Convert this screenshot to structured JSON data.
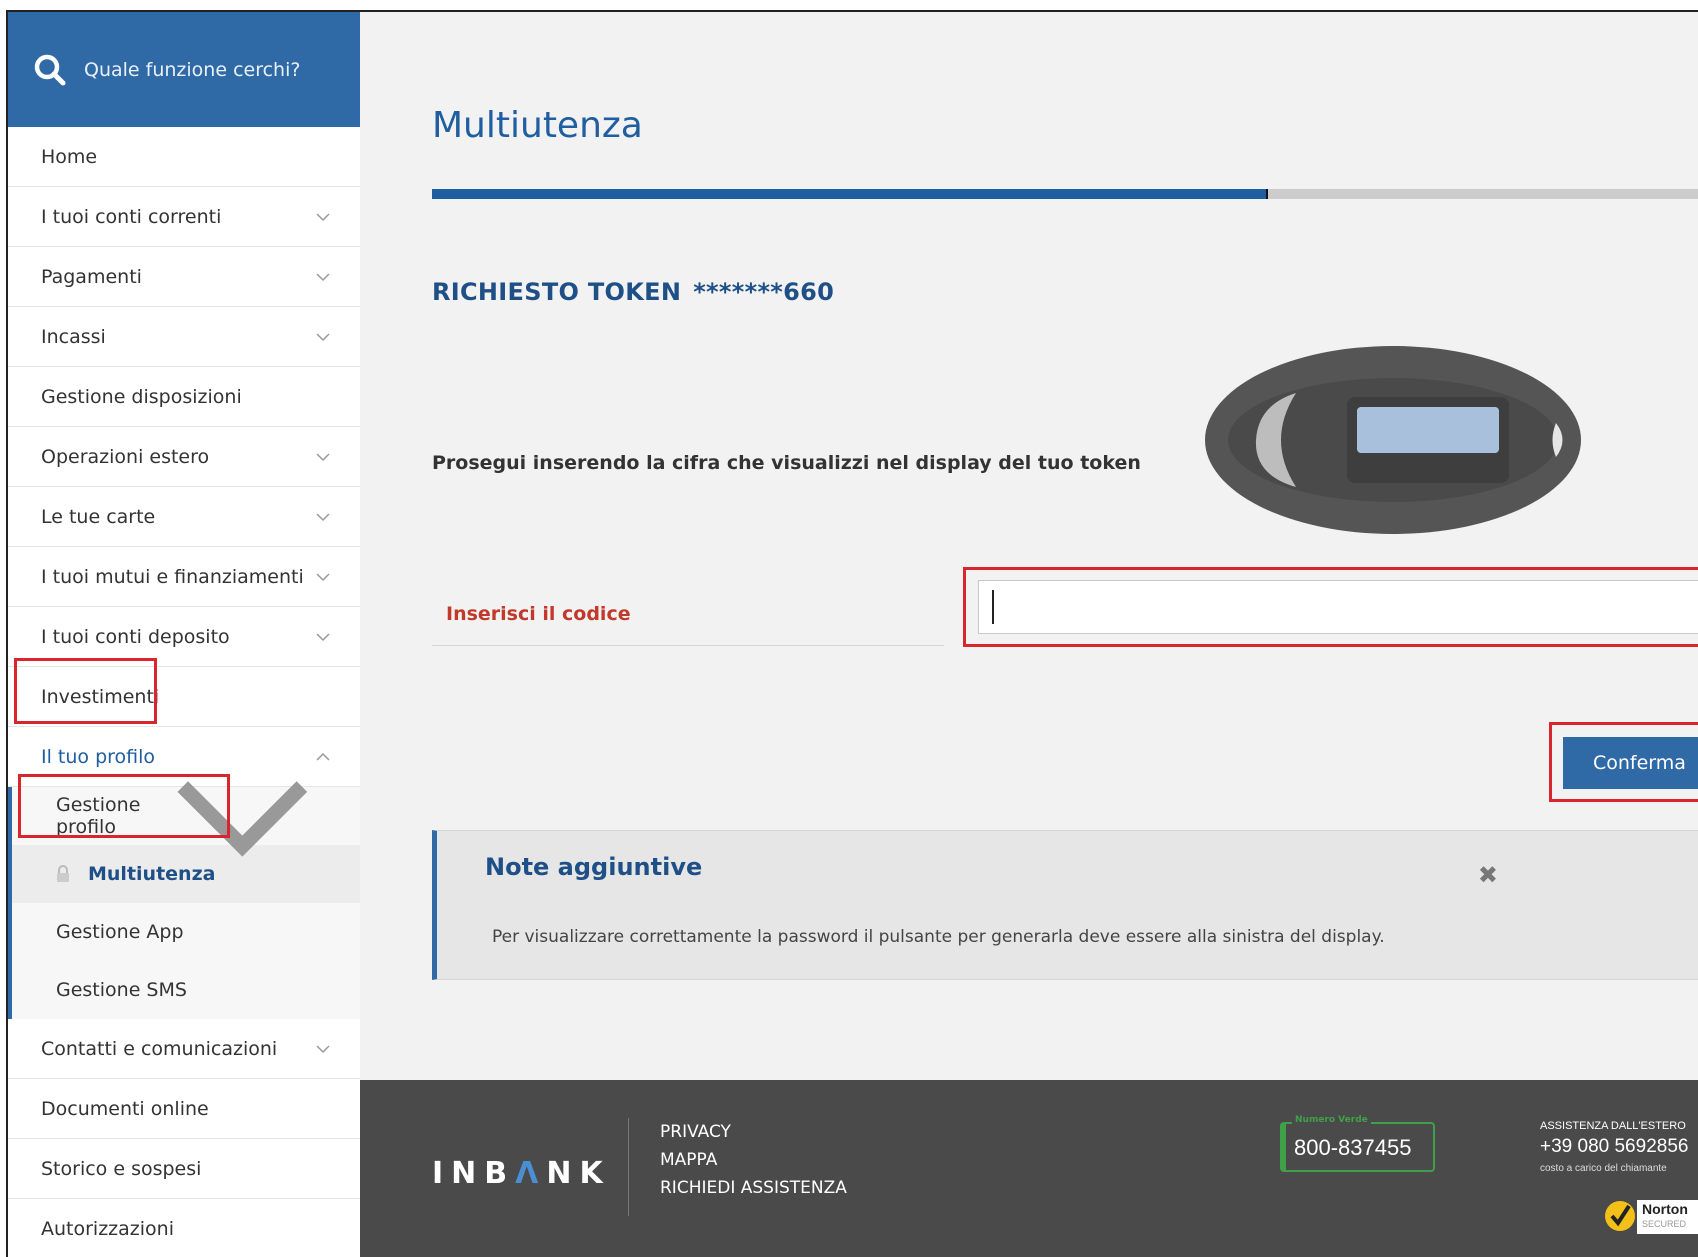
{
  "search": {
    "placeholder": "Quale funzione cerchi?"
  },
  "sidebar": {
    "items": [
      {
        "label": "Home",
        "has_chevron": false
      },
      {
        "label": "I tuoi conti correnti",
        "has_chevron": true
      },
      {
        "label": "Pagamenti",
        "has_chevron": true
      },
      {
        "label": "Incassi",
        "has_chevron": true
      },
      {
        "label": "Gestione disposizioni",
        "has_chevron": false
      },
      {
        "label": "Operazioni estero",
        "has_chevron": true
      },
      {
        "label": "Le tue carte",
        "has_chevron": true
      },
      {
        "label": "I tuoi mutui e finanziamenti",
        "has_chevron": true
      },
      {
        "label": "I tuoi conti deposito",
        "has_chevron": true
      },
      {
        "label": "Investimenti",
        "has_chevron": false
      },
      {
        "label": "Il tuo profilo",
        "has_chevron": true,
        "expanded": true
      }
    ],
    "profile_sub": [
      {
        "label": "Gestione profilo"
      },
      {
        "label": "Multiutenza",
        "current": true
      },
      {
        "label": "Gestione App"
      },
      {
        "label": "Gestione SMS"
      }
    ],
    "items_after": [
      {
        "label": "Contatti e comunicazioni",
        "has_chevron": true
      },
      {
        "label": "Documenti online",
        "has_chevron": false
      },
      {
        "label": "Storico e sospesi",
        "has_chevron": false
      },
      {
        "label": "Autorizzazioni",
        "has_chevron": false
      }
    ]
  },
  "main": {
    "title": "Multiutenza",
    "progress_fraction": 0.66,
    "token_title": "RICHIESTO TOKEN",
    "token_masked": "*******660",
    "instruction": "Prosegui inserendo la cifra che visualizzi nel display del tuo token",
    "code_label": "Inserisci il codice",
    "code_value": "",
    "confirm_label": "Conferma",
    "notes": {
      "title": "Note aggiuntive",
      "close_icon": "close-icon",
      "text": "Per visualizzare correttamente la password il pulsante per generarla deve essere alla sinistra del display."
    }
  },
  "footer": {
    "logo": {
      "before": "INB",
      "accent": "Λ",
      "after": "NK"
    },
    "links": [
      "PRIVACY",
      "MAPPA",
      "RICHIEDI ASSISTENZA"
    ],
    "phone_tag": "Numero Verde",
    "phone_number": "800-837455",
    "abroad_title": "ASSISTENZA DALL'ESTERO",
    "abroad_number": "+39 080 5692856",
    "abroad_note": "costo a carico del chiamante",
    "norton_label": "Norton",
    "norton_sub": "SECURED"
  },
  "colors": {
    "brand_blue": "#2f6aa7",
    "title_blue": "#1f5ea0",
    "highlight_red": "#d9262e",
    "footer_bg": "#4a4a4a"
  }
}
